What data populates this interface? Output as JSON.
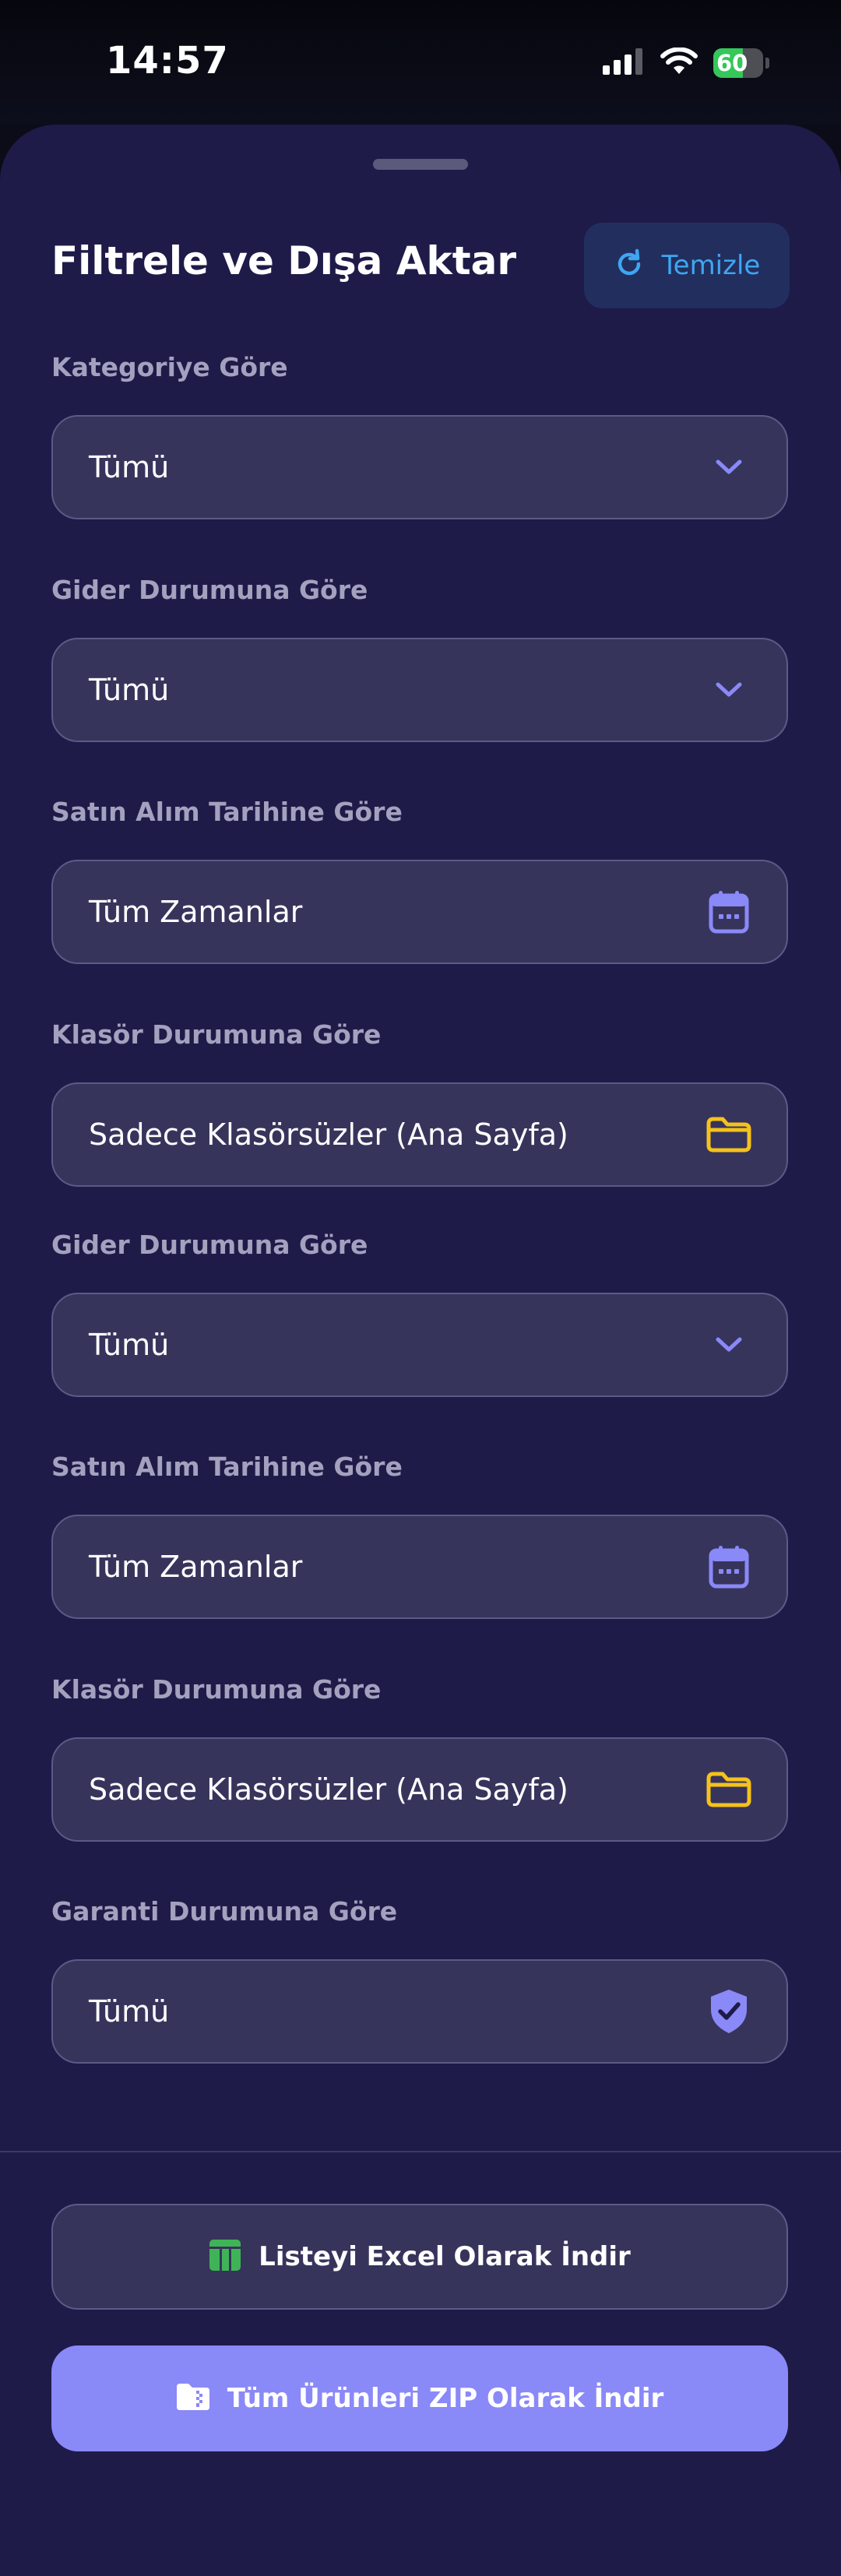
{
  "status_bar": {
    "time": "14:57",
    "battery_level": "60",
    "battery_fraction": 0.6,
    "battery_color": "#34c759"
  },
  "sheet": {
    "title": "Filtrele ve Dışa Aktar",
    "clear_button": {
      "label": "Temizle",
      "icon": "refresh-icon",
      "color": "#3fa6f2"
    },
    "filters": [
      {
        "label": "Kategoriye Göre",
        "value": "Tümü",
        "icon": "chevron-down-icon"
      },
      {
        "label": "Gider Durumuna Göre",
        "value": "Tümü",
        "icon": "chevron-down-icon"
      },
      {
        "label": "Satın Alım Tarihine Göre",
        "value": "Tüm Zamanlar",
        "icon": "calendar-icon"
      },
      {
        "label": "Klasör Durumuna Göre",
        "value": "Sadece Klasörsüzler (Ana Sayfa)",
        "icon": "folder-icon"
      },
      {
        "label": "Gider Durumuna Göre",
        "value": "Tümü",
        "icon": "chevron-down-icon"
      },
      {
        "label": "Satın Alım Tarihine Göre",
        "value": "Tüm Zamanlar",
        "icon": "calendar-icon"
      },
      {
        "label": "Klasör Durumuna Göre",
        "value": "Sadece Klasörsüzler (Ana Sayfa)",
        "icon": "folder-icon"
      },
      {
        "label": "Garanti Durumuna Göre",
        "value": "Tümü",
        "icon": "shield-check-icon"
      }
    ],
    "actions": {
      "excel": {
        "label": "Listeyi Excel Olarak İndir",
        "icon": "spreadsheet-icon",
        "icon_color": "#3fb456"
      },
      "zip": {
        "label": "Tüm Ürünleri ZIP Olarak İndir",
        "icon": "zip-folder-icon",
        "background": "#8a89f8"
      }
    }
  },
  "colors": {
    "sheet_background": "#1e1b49",
    "field_background": "#37345c",
    "accent": "#8a89f8",
    "folder": "#f5c21b"
  }
}
